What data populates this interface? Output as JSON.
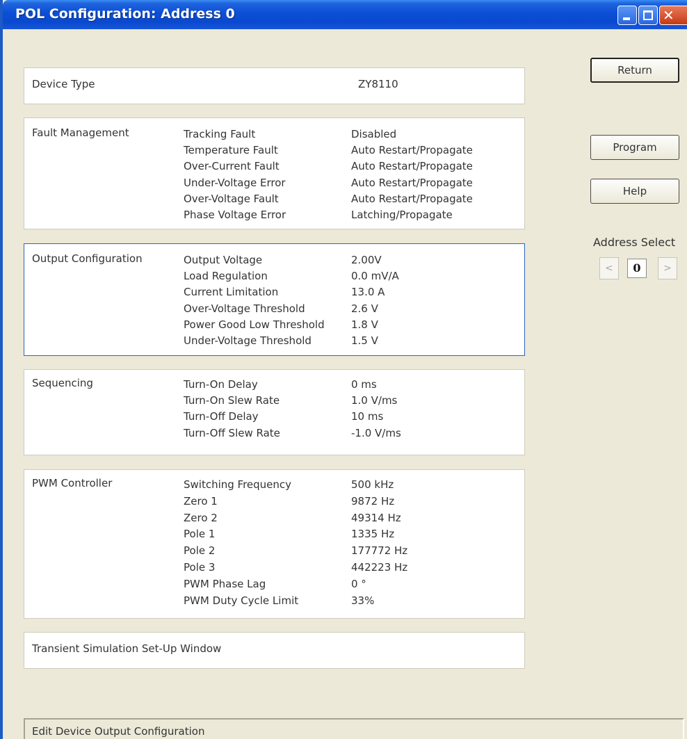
{
  "window": {
    "title": "POL Configuration: Address 0",
    "accent_color": "#0a49cf"
  },
  "device_type": {
    "label": "Device Type",
    "value": "ZY8110"
  },
  "fault_management": {
    "title": "Fault Management",
    "rows": [
      {
        "name": "Tracking Fault",
        "value": "Disabled"
      },
      {
        "name": "Temperature Fault",
        "value": "Auto Restart/Propagate"
      },
      {
        "name": "Over-Current Fault",
        "value": "Auto Restart/Propagate"
      },
      {
        "name": "Under-Voltage Error",
        "value": "Auto Restart/Propagate"
      },
      {
        "name": "Over-Voltage Fault",
        "value": "Auto Restart/Propagate"
      },
      {
        "name": "Phase Voltage Error",
        "value": "Latching/Propagate"
      }
    ]
  },
  "output_configuration": {
    "title": "Output Configuration",
    "rows": [
      {
        "name": "Output Voltage",
        "value": "2.00V"
      },
      {
        "name": "Load Regulation",
        "value": "0.0 mV/A"
      },
      {
        "name": "Current Limitation",
        "value": "13.0 A"
      },
      {
        "name": "Over-Voltage Threshold",
        "value": "2.6 V"
      },
      {
        "name": "Power Good Low Threshold",
        "value": "1.8 V"
      },
      {
        "name": "Under-Voltage Threshold",
        "value": "1.5 V"
      }
    ]
  },
  "sequencing": {
    "title": "Sequencing",
    "rows": [
      {
        "name": "Turn-On Delay",
        "value": "0 ms"
      },
      {
        "name": "Turn-On Slew Rate",
        "value": "1.0 V/ms"
      },
      {
        "name": "Turn-Off Delay",
        "value": "10 ms"
      },
      {
        "name": "Turn-Off Slew Rate",
        "value": "-1.0 V/ms"
      }
    ]
  },
  "pwm_controller": {
    "title": "PWM Controller",
    "rows": [
      {
        "name": "Switching Frequency",
        "value": "500 kHz"
      },
      {
        "name": "Zero 1",
        "value": "9872 Hz"
      },
      {
        "name": "Zero 2",
        "value": "49314 Hz"
      },
      {
        "name": "Pole 1",
        "value": "1335 Hz"
      },
      {
        "name": "Pole 2",
        "value": "177772 Hz"
      },
      {
        "name": "Pole 3",
        "value": "442223 Hz"
      },
      {
        "name": "PWM Phase Lag",
        "value": "0 °"
      },
      {
        "name": "PWM Duty Cycle Limit",
        "value": "33%"
      }
    ]
  },
  "transient": {
    "label": "Transient Simulation Set-Up Window"
  },
  "buttons": {
    "return_label": "Return",
    "program_label": "Program",
    "help_label": "Help"
  },
  "address_select": {
    "label": "Address Select",
    "prev": "<",
    "value": "0",
    "next": ">"
  },
  "status": {
    "text": "Edit Device Output Configuration"
  }
}
